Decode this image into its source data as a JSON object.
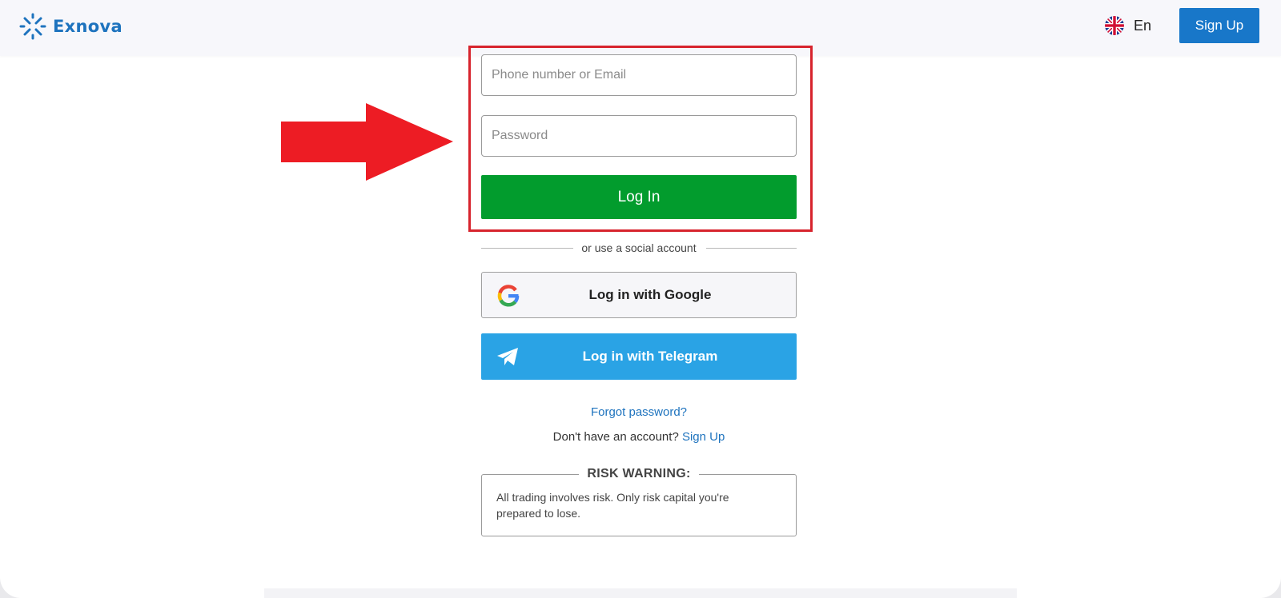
{
  "header": {
    "logo_text": "Exnova",
    "language_label": "En",
    "signup_label": "Sign Up"
  },
  "login_form": {
    "identifier_placeholder": "Phone number or Email",
    "password_placeholder": "Password",
    "login_label": "Log In"
  },
  "social": {
    "divider_text": "or use a social account",
    "google_label": "Log in with Google",
    "telegram_label": "Log in with Telegram"
  },
  "links": {
    "forgot_password": "Forgot password?",
    "no_account_text": "Don't have an account?",
    "signup_link": "Sign Up"
  },
  "risk_warning": {
    "title": "RISK WARNING:",
    "text": "All trading involves risk. Only risk capital you're prepared to lose."
  },
  "colors": {
    "brand_blue": "#1e73be",
    "login_green": "#029c2d",
    "telegram_blue": "#2aa3e5",
    "highlight_red": "#d7242d",
    "arrow_red": "#ed1c24"
  },
  "icons": {
    "logo": "exnova-logo-icon",
    "flag": "uk-flag-icon",
    "google": "google-icon",
    "telegram": "telegram-icon",
    "annotation": "red-arrow-icon"
  }
}
